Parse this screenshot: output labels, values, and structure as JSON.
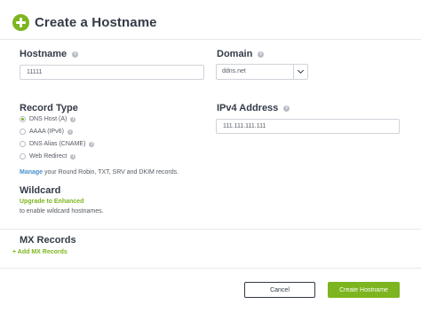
{
  "header": {
    "title": "Create a Hostname",
    "icon": "plus-circle-icon",
    "accent": "#7cb51f"
  },
  "hostname": {
    "label": "Hostname",
    "value": "11111"
  },
  "domain": {
    "label": "Domain",
    "value": "ddns.net"
  },
  "record_type": {
    "label": "Record Type",
    "options": [
      {
        "label": "DNS Host (A)",
        "checked": true
      },
      {
        "label": "AAAA (IPv6)",
        "checked": false
      },
      {
        "label": "DNS Alias (CNAME)",
        "checked": false
      },
      {
        "label": "Web Redirect",
        "checked": false
      }
    ]
  },
  "ipv4": {
    "label": "IPv4 Address",
    "value": "111.111.111.111"
  },
  "manage_note": {
    "link": "Manage",
    "text": "your Round Robin, TXT, SRV and DKIM records."
  },
  "wildcard": {
    "label": "Wildcard",
    "link": "Upgrade to Enhanced",
    "text": "to enable wildcard hostnames."
  },
  "mx": {
    "label": "MX Records",
    "add_link": "+ Add MX Records"
  },
  "buttons": {
    "cancel": "Cancel",
    "create": "Create Hostname"
  }
}
